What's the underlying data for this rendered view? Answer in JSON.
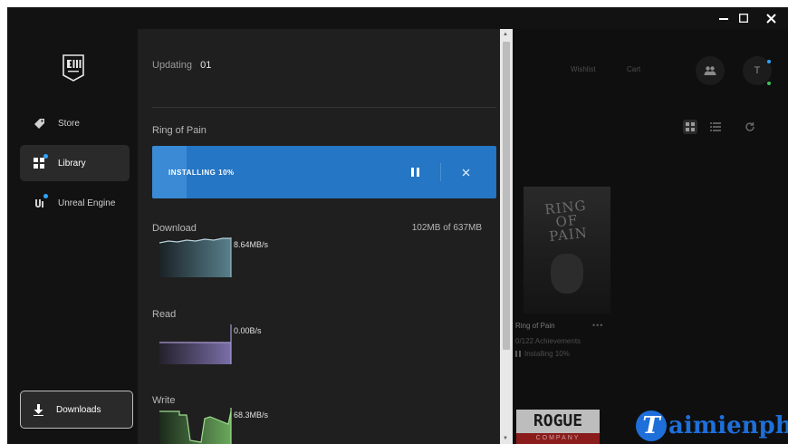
{
  "window": {
    "minimize": "minimize",
    "maximize": "maximize",
    "close": "close"
  },
  "sidebar": {
    "items": [
      {
        "label": "Store",
        "icon": "tag-icon"
      },
      {
        "label": "Library",
        "icon": "grid-icon",
        "active": true
      },
      {
        "label": "Unreal Engine",
        "icon": "unreal-icon"
      }
    ],
    "downloads_label": "Downloads"
  },
  "downloads": {
    "updating_label": "Updating",
    "updating_count": "01",
    "game_name": "Ring of Pain",
    "status_label": "INSTALLING 10%",
    "progress": 0.1,
    "download": {
      "label": "Download",
      "rate": "8.64MB/s",
      "size": "102MB of 637MB"
    },
    "read": {
      "label": "Read",
      "rate": "0.00B/s"
    },
    "write": {
      "label": "Write",
      "rate": "68.3MB/s"
    }
  },
  "library": {
    "header": {
      "wishlist": "Wishlist",
      "cart": "Cart",
      "avatar": "T"
    },
    "game": {
      "cover_text": "RING\nOF\nPAIN",
      "title": "Ring of Pain",
      "more": "•••",
      "achievements": "0/122 Achievements",
      "status": "Installing 10%"
    },
    "next_game": {
      "title": "ROGUE",
      "subtitle": "COMPANY"
    }
  },
  "watermark": {
    "letter": "T",
    "text": "aimienphi"
  },
  "colors": {
    "accent": "#2576c4",
    "notify": "#2fa4ff",
    "online": "#3ec25a",
    "download_graph": "#5c8fa0",
    "read_graph": "#8c7fbf",
    "write_graph": "#7fc46f"
  }
}
